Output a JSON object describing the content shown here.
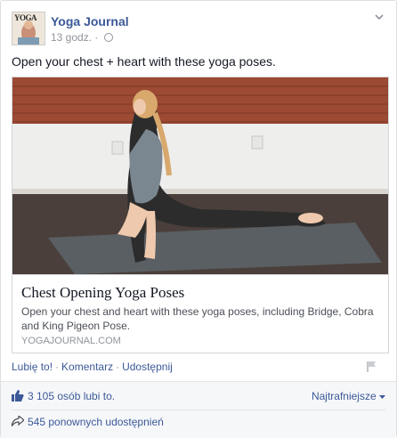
{
  "post": {
    "page_name": "Yoga Journal",
    "timestamp": "13 godz.",
    "separator": "·",
    "text": "Open your chest + heart with these yoga poses.",
    "avatar_text": "YOGA"
  },
  "link": {
    "title": "Chest Opening Yoga Poses",
    "description": "Open your chest and heart with these yoga poses, including Bridge, Cobra and King Pigeon Pose.",
    "domain": "YOGAJOURNAL.COM"
  },
  "actions": {
    "like": "Lubię to!",
    "comment": "Komentarz",
    "share": "Udostępnij",
    "dot": "·"
  },
  "ufi": {
    "likes": "3 105 osób lubi to.",
    "sort": "Najtrafniejsze",
    "shares": "545 ponownych udostępnień"
  },
  "colors": {
    "link_blue": "#3b5998",
    "muted": "#90949c",
    "brick": "#9c4a33"
  },
  "icons": [
    "globe-icon",
    "chevron-down-icon",
    "flag-icon",
    "thumbs-up-icon",
    "share-arrow-icon",
    "sort-caret-icon"
  ]
}
